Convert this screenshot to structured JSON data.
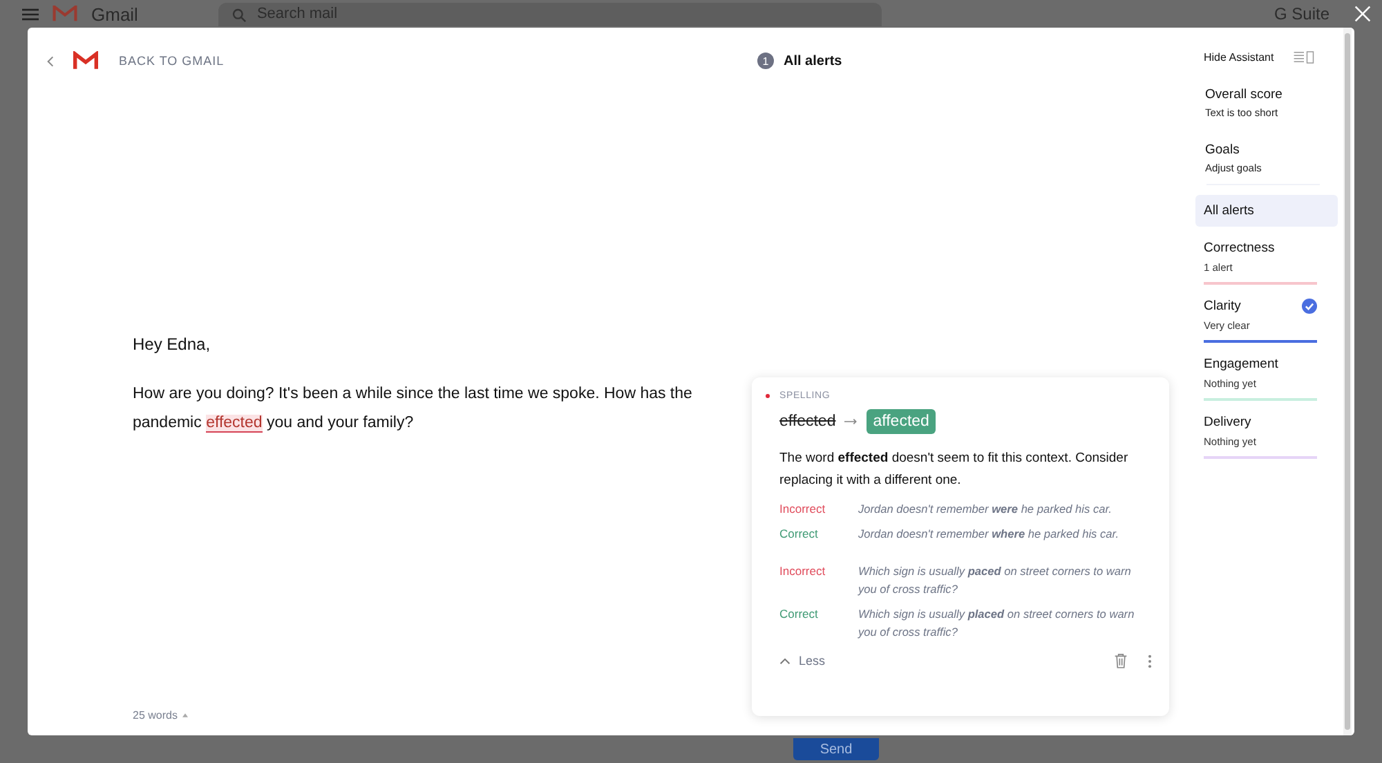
{
  "background": {
    "app_name": "Gmail",
    "search": {
      "placeholder": "Search mail"
    },
    "suite_label": "G Suite",
    "send_button": "Send"
  },
  "header": {
    "back_label": "BACK TO GMAIL",
    "alert_count": "1",
    "alerts_title": "All alerts"
  },
  "document": {
    "greeting": "Hey Edna,",
    "text_before": "How are you doing? It's been a while since the last time we spoke. How has the pandemic ",
    "flagged_word": "effected",
    "text_after": " you and your family?",
    "word_count": "25 words"
  },
  "card": {
    "category": "SPELLING",
    "wrong": "effected",
    "suggestion": "affected",
    "explanation": "The word **effected** doesn't seem to fit this context. Consider replacing it with a different one.",
    "examples": [
      {
        "kind": "incorrect",
        "label": "Incorrect",
        "text": "Jordan doesn't remember **were** he parked his car."
      },
      {
        "kind": "correct",
        "label": "Correct",
        "text": "Jordan doesn't remember **where** he parked his car."
      },
      {
        "kind": "incorrect",
        "label": "Incorrect",
        "text": "Which sign is usually **paced** on street corners to warn you of cross traffic?"
      },
      {
        "kind": "correct",
        "label": "Correct",
        "text": "Which sign is usually **placed** on street corners to warn you of cross traffic?"
      }
    ],
    "less_label": "Less"
  },
  "sidebar": {
    "hide_label": "Hide Assistant",
    "sections": [
      {
        "title": "Overall score",
        "subtitle": "Text is too short"
      },
      {
        "title": "Goals",
        "subtitle": "Adjust goals"
      }
    ],
    "all_alerts": {
      "label": "All alerts",
      "selected": true
    },
    "categories": [
      {
        "name": "Correctness",
        "status": "1 alert",
        "color": "#f7c5cc",
        "checked": false
      },
      {
        "name": "Clarity",
        "status": "Very clear",
        "color": "#4a6ee0",
        "checked": true
      },
      {
        "name": "Engagement",
        "status": "Nothing yet",
        "color": "#c8efdf",
        "checked": false
      },
      {
        "name": "Delivery",
        "status": "Nothing yet",
        "color": "#e6d5f7",
        "checked": false
      }
    ]
  }
}
